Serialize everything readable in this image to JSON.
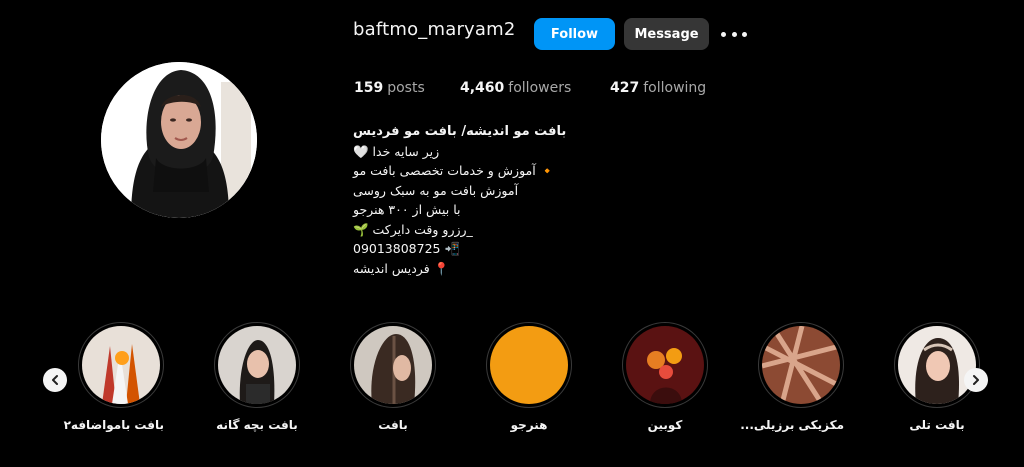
{
  "profile": {
    "username": "baftmo_maryam2",
    "follow_label": "Follow",
    "message_label": "Message",
    "more_icon": "more-options-icon"
  },
  "stats": {
    "posts_count": "159",
    "posts_label": "posts",
    "followers_count": "4,460",
    "followers_label": "followers",
    "following_count": "427",
    "following_label": "following"
  },
  "bio": {
    "name": "بافت مو اندیشه/ بافت مو فردیس",
    "lines": [
      "زیر سایه خدا 🤍",
      "🔸 آموزش و خدمات تخصصی بافت مو",
      "آموزش بافت مو به سبک روسی",
      "با بیش از ۳۰۰ هنرجو",
      "_رزرو وقت دایرکت 🌱",
      "09013808725 📲",
      "📍 فردیس اندیشه"
    ]
  },
  "highlights": [
    {
      "label": "بافت بامواضافه۲"
    },
    {
      "label": "بافت بچه گانه"
    },
    {
      "label": "بافت"
    },
    {
      "label": "هنرجو"
    },
    {
      "label": "کوبین"
    },
    {
      "label": "مکزیکی برزیلی..."
    },
    {
      "label": "بافت تلی"
    }
  ],
  "colors": {
    "background": "#000000",
    "follow_button": "#0095f6",
    "message_button": "#363636",
    "text": "#f5f5f5",
    "muted": "#a8a8a8",
    "orange_highlight": "#f39c12"
  },
  "icons": {
    "prev": "chevron-left-icon",
    "next": "chevron-right-icon"
  }
}
